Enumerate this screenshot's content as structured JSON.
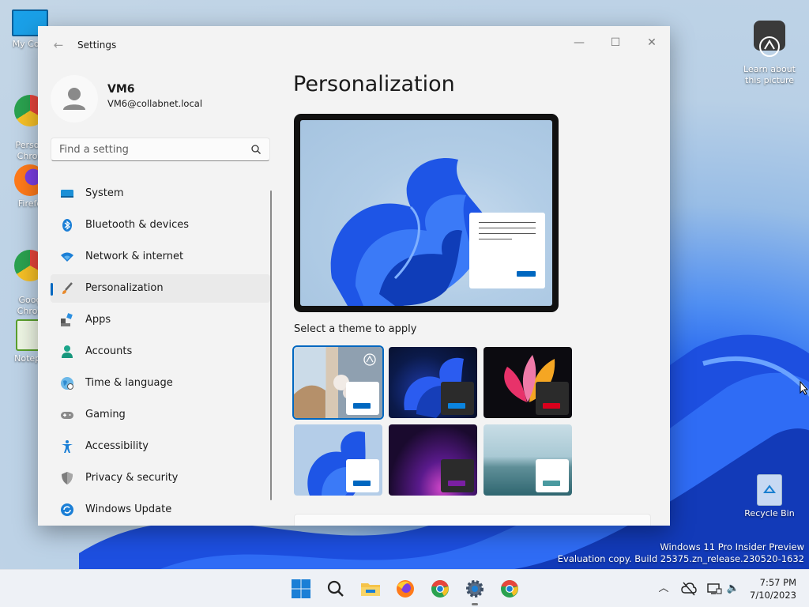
{
  "desktop": {
    "icons": [
      {
        "label": "My Com",
        "color": "#1aa0e8"
      },
      {
        "label": "Person\nChron",
        "color": "#e8453c"
      },
      {
        "label": "Firefo",
        "color": "#ff7a1a"
      },
      {
        "label": "Goog\nChron",
        "color": "#e8453c"
      },
      {
        "label": "Notepa",
        "color": "#5aa02c"
      }
    ],
    "learn_label": "Learn about\nthis picture",
    "recycle_label": "Recycle Bin",
    "watermark_line1": "Windows 11 Pro Insider Preview",
    "watermark_line2": "Evaluation copy. Build 25375.zn_release.230520-1632"
  },
  "window": {
    "title": "Settings",
    "minimize_glyph": "—",
    "maximize_glyph": "☐",
    "close_glyph": "✕",
    "back_glyph": "←"
  },
  "profile": {
    "name": "VM6",
    "email": "VM6@collabnet.local"
  },
  "search": {
    "placeholder": "Find a setting"
  },
  "nav": {
    "items": [
      {
        "label": "System",
        "icon": "system-icon"
      },
      {
        "label": "Bluetooth & devices",
        "icon": "bluetooth-icon"
      },
      {
        "label": "Network & internet",
        "icon": "wifi-icon"
      },
      {
        "label": "Personalization",
        "icon": "brush-icon"
      },
      {
        "label": "Apps",
        "icon": "apps-icon"
      },
      {
        "label": "Accounts",
        "icon": "accounts-icon"
      },
      {
        "label": "Time & language",
        "icon": "globe-icon"
      },
      {
        "label": "Gaming",
        "icon": "gamepad-icon"
      },
      {
        "label": "Accessibility",
        "icon": "accessibility-icon"
      },
      {
        "label": "Privacy & security",
        "icon": "shield-icon"
      },
      {
        "label": "Windows Update",
        "icon": "update-icon"
      }
    ],
    "active_index": 3
  },
  "main": {
    "title": "Personalization",
    "theme_label": "Select a theme to apply",
    "selected_theme": 0
  },
  "taskbar": {
    "time": "7:57 PM",
    "date": "7/10/2023",
    "chevron_glyph": "︿",
    "volume_glyph": "🔈"
  },
  "colors": {
    "accent": "#0067c0",
    "window_bg": "#f3f3f3",
    "taskbar_bg": "#eef1f6"
  }
}
